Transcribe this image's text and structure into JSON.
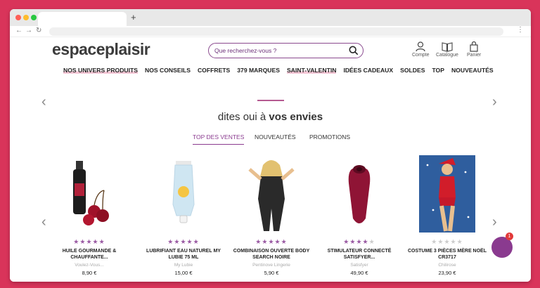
{
  "browser": {
    "new_tab_icon": "+",
    "menu_icon": "⋮"
  },
  "header": {
    "logo": "espaceplaisir",
    "search_placeholder": "Que recherchez-vous ?",
    "account_label": "Compte",
    "catalogue_label": "Catalogue",
    "cart_label": "Panier"
  },
  "nav": {
    "items": [
      "NOS UNIVERS PRODUITS",
      "NOS CONSEILS",
      "COFFRETS",
      "379 MARQUES",
      "SAINT-VALENTIN",
      "IDÉES CADEAUX",
      "SOLDES",
      "TOP",
      "NOUVEAUTÉS"
    ]
  },
  "section": {
    "heading_pre": "dites oui à ",
    "heading_bold": "vos envies",
    "tabs": [
      "TOP DES VENTES",
      "NOUVEAUTÉS",
      "PROMOTIONS"
    ],
    "active_tab": "TOP DES VENTES"
  },
  "products": [
    {
      "name": "HUILE GOURMANDE & CHAUFFANTE...",
      "brand": "Voulez-Vous...",
      "price": "8,90 €",
      "rating": 5
    },
    {
      "name": "LUBRIFIANT EAU NATUREL MY LUBIE 75 ML",
      "brand": "My Lubie",
      "price": "15,00 €",
      "rating": 5
    },
    {
      "name": "COMBINAISON OUVERTE BODY SEARCH NOIRE",
      "brand": "Pentinove Lingerie",
      "price": "5,90 €",
      "rating": 5
    },
    {
      "name": "STIMULATEUR CONNECTÉ SATISFYER...",
      "brand": "Satisfyer",
      "price": "49,90 €",
      "rating": 4
    },
    {
      "name": "COSTUME 3 PIÈCES MÈRE NOËL CR3717",
      "brand": "Chilirose",
      "price": "23,90 €",
      "rating": 0
    }
  ],
  "chat": {
    "badge": "1",
    "icon": "?"
  },
  "colors": {
    "accent": "#8a3a8f",
    "background": "#d9345a"
  }
}
